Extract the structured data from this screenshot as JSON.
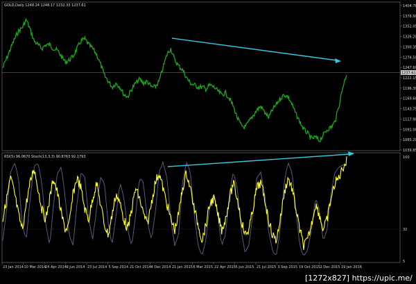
{
  "window": {
    "title": "GOLD,Daily 1248.24 1248.17 1232.33 1237.61"
  },
  "indicator": {
    "title": "RSI(5) 96.0670  Stoch(13,3,3) 90.8763 92.1793"
  },
  "price_axis": {
    "labels": [
      "1404.78",
      "1378.90",
      "1352.05",
      "1326.20",
      "1300.35",
      "1274.50",
      "1247.60",
      "1222.15",
      "1196.30",
      "1169.60",
      "1143.75",
      "1117.90",
      "1091.00",
      "1065.20",
      "1039.85"
    ],
    "current_price": "1237.61"
  },
  "oscillator_axis": {
    "labels": [
      "100",
      "32",
      "5"
    ]
  },
  "time_axis": {
    "labels": [
      "23 Jan 2014",
      "10 Mar 2014",
      "24 Apr 2014",
      "9 Jun 2014",
      "23 Jul 2014",
      "5 Sep 2014",
      "21 Oct 2014",
      "4 Dec 2014",
      "21 Jan 2015",
      "6 Mar 2015",
      "22 Apr 2015",
      "5 Jun 2015",
      "21 Jul 2015",
      "3 Sep 2015",
      "19 Oct 2015",
      "2 Dec 2015",
      "19 Jan 2016"
    ]
  },
  "watermark": "[1272x827] https://upic.me/",
  "colors": {
    "price": "#1fa51f",
    "rsi": "#ffff33",
    "stoch": "#5a5a7a",
    "trend": "#39c7dc",
    "grid": "#808080"
  },
  "chart_data": [
    {
      "type": "line",
      "series": [
        {
          "values": [
            1250,
            1275,
            1300,
            1325,
            1345,
            1355,
            1375,
            1350,
            1320,
            1310,
            1300,
            1310,
            1310,
            1300,
            1295,
            1280,
            1265,
            1270,
            1280,
            1300,
            1320,
            1325,
            1310,
            1300,
            1285,
            1260,
            1230,
            1215,
            1200,
            1210,
            1200,
            1180,
            1175,
            1195,
            1210,
            1220,
            1210,
            1215,
            1200,
            1200,
            1215,
            1250,
            1285,
            1300,
            1270,
            1255,
            1245,
            1225,
            1210,
            1205,
            1200,
            1200,
            1195,
            1205,
            1200,
            1190,
            1180,
            1185,
            1170,
            1150,
            1120,
            1100,
            1095,
            1110,
            1125,
            1140,
            1150,
            1135,
            1120,
            1140,
            1155,
            1170,
            1180,
            1175,
            1155,
            1130,
            1110,
            1090,
            1080,
            1065,
            1070,
            1060,
            1075,
            1090,
            1095,
            1110,
            1150,
            1200,
            1235
          ]
        }
      ],
      "current_value": 1237.61,
      "ylim": [
        1039.85,
        1404.78
      ]
    },
    {
      "type": "line",
      "series": [
        {
          "values": [
            40,
            60,
            80,
            65,
            45,
            30,
            55,
            75,
            90,
            70,
            50,
            40,
            60,
            80,
            65,
            45,
            30,
            35,
            65,
            80,
            70,
            50,
            40,
            60,
            75,
            55,
            35,
            25,
            45,
            65,
            55,
            40,
            30,
            50,
            70,
            60,
            45,
            35,
            55,
            75,
            85,
            70,
            55,
            40,
            30,
            45,
            70,
            85,
            70,
            50,
            35,
            20,
            35,
            55,
            60,
            45,
            30,
            40,
            60,
            75,
            60,
            40,
            25,
            30,
            50,
            70,
            75,
            60,
            40,
            25,
            20,
            40,
            65,
            80,
            70,
            50,
            30,
            15,
            20,
            35,
            55,
            45,
            30,
            40,
            60,
            75,
            80,
            90,
            96
          ]
        },
        {
          "values": [
            20,
            50,
            85,
            95,
            80,
            35,
            20,
            60,
            90,
            95,
            75,
            35,
            15,
            55,
            85,
            90,
            60,
            25,
            15,
            55,
            85,
            80,
            40,
            20,
            50,
            80,
            75,
            35,
            15,
            45,
            75,
            60,
            30,
            15,
            45,
            80,
            75,
            40,
            20,
            45,
            85,
            95,
            80,
            40,
            15,
            25,
            75,
            95,
            85,
            45,
            15,
            5,
            20,
            55,
            65,
            45,
            15,
            25,
            65,
            85,
            70,
            30,
            8,
            15,
            45,
            80,
            85,
            65,
            30,
            10,
            5,
            30,
            75,
            95,
            85,
            50,
            15,
            5,
            10,
            30,
            60,
            50,
            20,
            30,
            65,
            85,
            90,
            92,
            92
          ]
        }
      ],
      "ylim": [
        0,
        100
      ]
    }
  ]
}
